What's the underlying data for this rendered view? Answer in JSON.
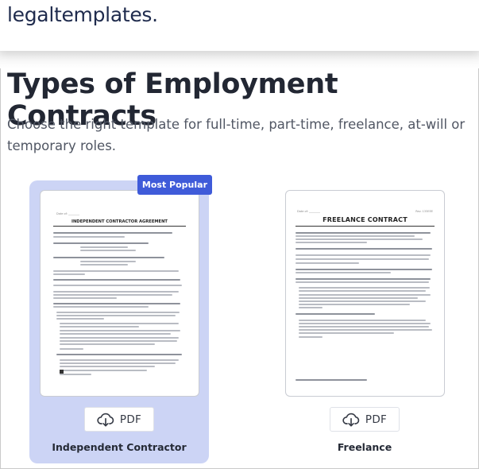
{
  "header": {
    "logo_text": "legaltemplates."
  },
  "main": {
    "title": "Types of Employment Contracts",
    "subtitle": "Choose the right template for full-time, part-time, freelance, at-will or temporary roles."
  },
  "cards": [
    {
      "label": "Independent Contractor",
      "badge": "Most Popular",
      "selected": true,
      "button_label": "PDF",
      "doc_title": "INDEPENDENT CONTRACTOR AGREEMENT"
    },
    {
      "label": "Freelance",
      "badge": "",
      "selected": false,
      "button_label": "PDF",
      "doc_title": "FREELANCE CONTRACT"
    }
  ],
  "colors": {
    "selected_card_bg": "#ccd4f5",
    "badge_bg": "#3f5bd9",
    "logo": "#1f2b4d"
  },
  "icons": {
    "pdf_button": "download-cloud-icon"
  }
}
